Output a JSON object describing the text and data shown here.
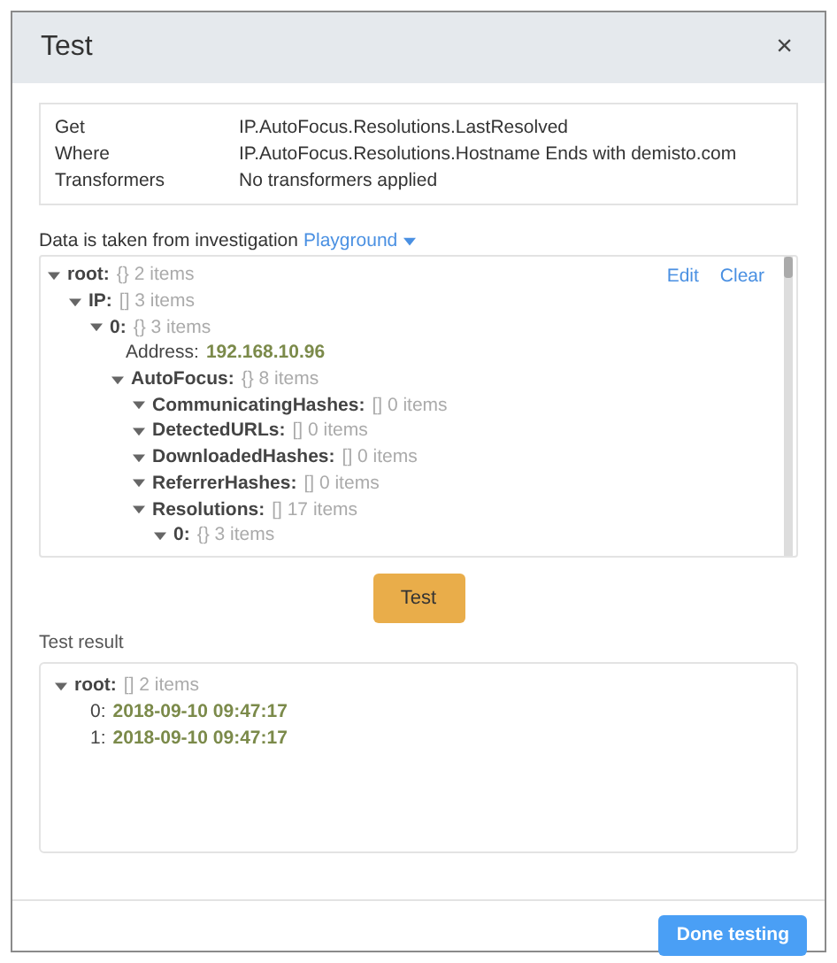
{
  "dialog": {
    "title": "Test",
    "close": "×"
  },
  "summary": [
    {
      "label": "Get",
      "value": "IP.AutoFocus.Resolutions.LastResolved"
    },
    {
      "label": "Where",
      "value": "IP.AutoFocus.Resolutions.Hostname Ends with demisto.com"
    },
    {
      "label": "Transformers",
      "value": "No transformers applied"
    }
  ],
  "source": {
    "text": "Data is taken from investigation",
    "investigation": "Playground"
  },
  "data_tree": {
    "actions": [
      "Edit",
      "Clear"
    ],
    "nodes": [
      {
        "key": "root:",
        "summary": "{} 2 items",
        "expanded": true,
        "children": [
          {
            "key": "IP:",
            "summary": "[] 3 items",
            "expanded": true,
            "children": [
              {
                "key": "0:",
                "summary": "{} 3 items",
                "expanded": true,
                "children": [
                  {
                    "key": "Address:",
                    "value": "192.168.10.96"
                  },
                  {
                    "key": "AutoFocus:",
                    "summary": "{} 8 items",
                    "expanded": true,
                    "children": [
                      {
                        "key": "CommunicatingHashes:",
                        "summary": "[] 0 items",
                        "expanded": true
                      },
                      {
                        "key": "DetectedURLs:",
                        "summary": "[] 0 items",
                        "expanded": true
                      },
                      {
                        "key": "DownloadedHashes:",
                        "summary": "[] 0 items",
                        "expanded": true
                      },
                      {
                        "key": "ReferrerHashes:",
                        "summary": "[] 0 items",
                        "expanded": true
                      },
                      {
                        "key": "Resolutions:",
                        "summary": "[] 17 items",
                        "expanded": true,
                        "children": [
                          {
                            "key": "0:",
                            "summary": "{} 3 items",
                            "expanded": true
                          }
                        ]
                      }
                    ]
                  }
                ]
              }
            ]
          }
        ]
      }
    ]
  },
  "test_button": "Test",
  "result": {
    "label": "Test result",
    "nodes": [
      {
        "key": "root:",
        "summary": "[] 2 items",
        "expanded": true,
        "children": [
          {
            "key": "0:",
            "value": "2018-09-10 09:47:17"
          },
          {
            "key": "1:",
            "value": "2018-09-10 09:47:17"
          }
        ]
      }
    ]
  },
  "done_button": "Done testing"
}
